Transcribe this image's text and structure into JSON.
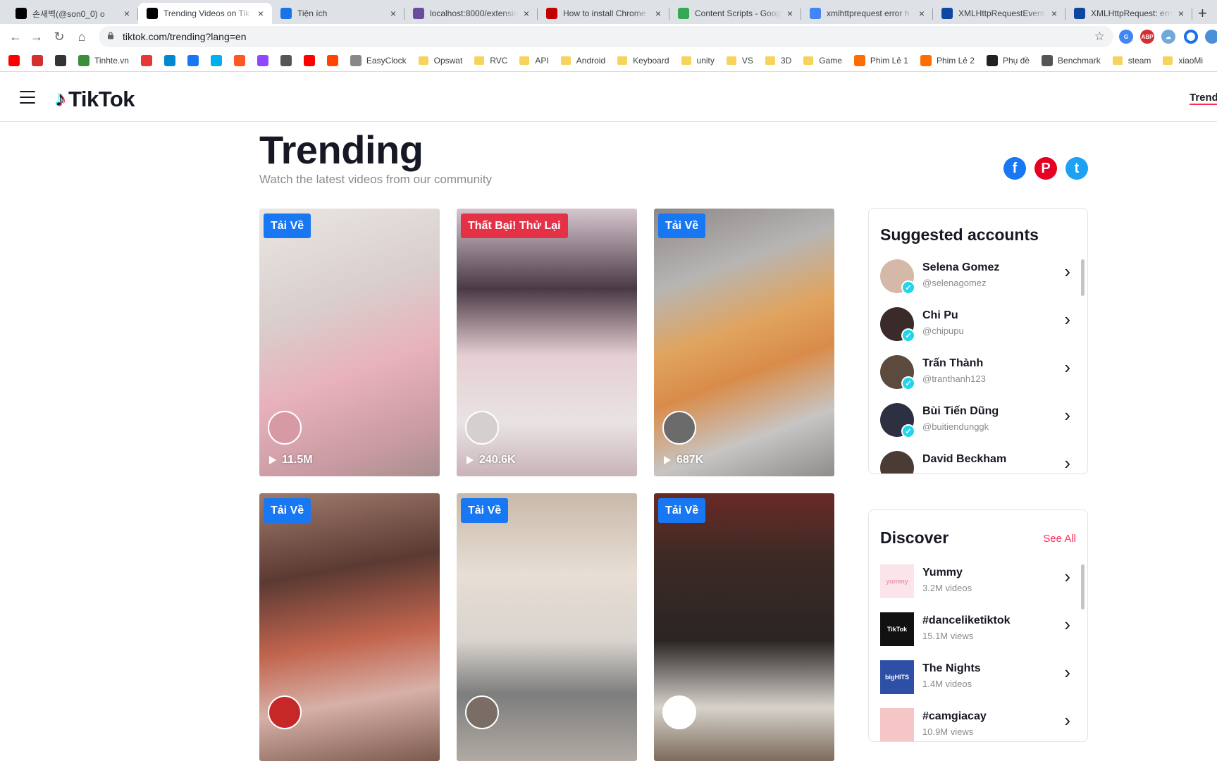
{
  "browser": {
    "tabs": [
      {
        "title": "손새벽(@son0_0) o",
        "favicon": "tiktok-icon",
        "color": "#000000",
        "active": false
      },
      {
        "title": "Trending Videos on Tik",
        "favicon": "tiktok-icon",
        "color": "#000000",
        "active": true
      },
      {
        "title": "Tiện ích",
        "favicon": "puzzle-icon",
        "color": "#1a73e8",
        "active": false
      },
      {
        "title": "localhost:8000/extensio",
        "favicon": "globe-icon",
        "color": "#6a4c9c",
        "active": false
      },
      {
        "title": "How to install Chrome",
        "favicon": "cnet-icon",
        "color": "#c10000",
        "active": false
      },
      {
        "title": "Content Scripts - Goog",
        "favicon": "chrome-icon",
        "color": "#34a853",
        "active": false
      },
      {
        "title": "xmlhttprequest error h",
        "favicon": "google-icon",
        "color": "#4285f4",
        "active": false
      },
      {
        "title": "XMLHttpRequestEvent",
        "favicon": "mortarboard-icon",
        "color": "#0d47a1",
        "active": false
      },
      {
        "title": "XMLHttpRequest: error",
        "favicon": "mortarboard-icon",
        "color": "#0d47a1",
        "active": false
      }
    ],
    "url": "tiktok.com/trending?lang=en",
    "bookmarks": [
      {
        "label": "",
        "icon": "youtube-icon",
        "color": "#ff0000",
        "folder": false
      },
      {
        "label": "",
        "icon": "bookmark-icon",
        "color": "#d32f2f",
        "folder": false
      },
      {
        "label": "",
        "icon": "gk-icon",
        "color": "#333333",
        "folder": false
      },
      {
        "label": "Tinhte.vn",
        "icon": "tinhte-icon",
        "color": "#3b8f3b",
        "folder": false
      },
      {
        "label": "",
        "icon": "circle-icon",
        "color": "#e53935",
        "folder": false
      },
      {
        "label": "",
        "icon": "cloud-icon",
        "color": "#0288d1",
        "folder": false
      },
      {
        "label": "",
        "icon": "facebook-icon",
        "color": "#1877f2",
        "folder": false
      },
      {
        "label": "",
        "icon": "skype-icon",
        "color": "#00aff0",
        "folder": false
      },
      {
        "label": "",
        "icon": "g-icon",
        "color": "#ff5722",
        "folder": false
      },
      {
        "label": "",
        "icon": "twitch-icon",
        "color": "#9146ff",
        "folder": false
      },
      {
        "label": "",
        "icon": "gear-icon",
        "color": "#555555",
        "folder": false
      },
      {
        "label": "",
        "icon": "play-icon",
        "color": "#ff0000",
        "folder": false
      },
      {
        "label": "",
        "icon": "play-icon",
        "color": "#ff4500",
        "folder": false
      },
      {
        "label": "EasyClock",
        "icon": "clock-icon",
        "color": "#888888",
        "folder": false
      },
      {
        "label": "Opswat",
        "icon": "folder-icon",
        "color": "#f7d35c",
        "folder": true
      },
      {
        "label": "RVC",
        "icon": "folder-icon",
        "color": "#f7d35c",
        "folder": true
      },
      {
        "label": "API",
        "icon": "folder-icon",
        "color": "#f7d35c",
        "folder": true
      },
      {
        "label": "Android",
        "icon": "folder-icon",
        "color": "#f7d35c",
        "folder": true
      },
      {
        "label": "Keyboard",
        "icon": "folder-icon",
        "color": "#f7d35c",
        "folder": true
      },
      {
        "label": "unity",
        "icon": "folder-icon",
        "color": "#f7d35c",
        "folder": true
      },
      {
        "label": "VS",
        "icon": "folder-icon",
        "color": "#f7d35c",
        "folder": true
      },
      {
        "label": "3D",
        "icon": "folder-icon",
        "color": "#f7d35c",
        "folder": true
      },
      {
        "label": "Game",
        "icon": "folder-icon",
        "color": "#f7d35c",
        "folder": true
      },
      {
        "label": "Phim Lẻ 1",
        "icon": "flame-icon",
        "color": "#ff6d00",
        "folder": false
      },
      {
        "label": "Phim Lẻ 2",
        "icon": "flame-icon",
        "color": "#ff6d00",
        "folder": false
      },
      {
        "label": "Phụ đề",
        "icon": "subtitle-icon",
        "color": "#222222",
        "folder": false
      },
      {
        "label": "Benchmark",
        "icon": "gamepad-icon",
        "color": "#555555",
        "folder": false
      },
      {
        "label": "steam",
        "icon": "folder-icon",
        "color": "#f7d35c",
        "folder": true
      },
      {
        "label": "xiaoMi",
        "icon": "folder-icon",
        "color": "#f7d35c",
        "folder": true
      }
    ]
  },
  "header": {
    "logo_text": "TikTok",
    "nav_link": "Trendi"
  },
  "page": {
    "title": "Trending",
    "subtitle": "Watch the latest videos from our community"
  },
  "share": [
    {
      "name": "facebook",
      "glyph": "f",
      "color": "#1877f2"
    },
    {
      "name": "pinterest",
      "glyph": "P",
      "color": "#e60023"
    },
    {
      "name": "twitter",
      "glyph": "t",
      "color": "#1da1f2"
    }
  ],
  "videos": [
    {
      "badge": "Tải Về",
      "badge_color": "#1877f2",
      "plays": "11.5M",
      "bg": "linear-gradient(160deg,#eae6e3 0%,#d9cfcd 35%,#e8b1bb 60%,#c89aa2 85%,#a78f8e 100%)",
      "avatar_color": "#d79aa4"
    },
    {
      "badge": "Thất Bại! Thử Lại",
      "badge_color": "#e53146",
      "plays": "240.6K",
      "bg": "linear-gradient(180deg,#d6c7cf 0%,#4a3a45 30%,#e6cfd3 55%,#e9e3e3 80%,#c9b3b7 100%)",
      "avatar_color": "#d6cfd0"
    },
    {
      "badge": "Tải Về",
      "badge_color": "#1877f2",
      "plays": "687K",
      "bg": "linear-gradient(160deg,#8d8887 0%,#b7b5b3 25%,#e0a45f 45%,#d98c4a 60%,#c7c5c4 80%,#8f8c8a 100%)",
      "avatar_color": "#6b6b6b"
    },
    {
      "badge": "Tải Về",
      "badge_color": "#1877f2",
      "plays": "",
      "bg": "linear-gradient(170deg,#a07b6c 0%,#5b3a33 30%,#c2654e 55%,#d7b0a7 75%,#7b5a4e 100%)",
      "avatar_color": "#c62828"
    },
    {
      "badge": "Tải Về",
      "badge_color": "#1877f2",
      "plays": "",
      "bg": "linear-gradient(180deg,#c9b9a9 0%,#e7ded5 30%,#d9d4ce 55%,#7d7d7d 75%,#b1aaa3 100%)",
      "avatar_color": "#7a6d65"
    },
    {
      "badge": "Tải Về",
      "badge_color": "#1877f2",
      "plays": "",
      "bg": "linear-gradient(180deg,#6a2a26 0%,#3b2a25 25%,#2b2524 55%,#d7d3cc 80%,#7e6b5c 100%)",
      "avatar_color": "#ffffff"
    }
  ],
  "suggested": {
    "title": "Suggested accounts",
    "accounts": [
      {
        "name": "Selena Gomez",
        "handle": "@selenagomez",
        "color": "#d4b8a8"
      },
      {
        "name": "Chi Pu",
        "handle": "@chipupu",
        "color": "#3a2a2a"
      },
      {
        "name": "Trấn Thành",
        "handle": "@tranthanh123",
        "color": "#5d4a3e"
      },
      {
        "name": "Bùi Tiến Dũng",
        "handle": "@buitiendunggk",
        "color": "#2d3040"
      },
      {
        "name": "David Beckham",
        "handle": "",
        "color": "#4a3c35"
      }
    ]
  },
  "discover": {
    "title": "Discover",
    "see_all": "See All",
    "items": [
      {
        "name": "Yummy",
        "sub": "3.2M videos",
        "color": "#fbe4ea",
        "thumb_text": "yummy",
        "thumb_text_color": "#e89bb0"
      },
      {
        "name": "#danceliketiktok",
        "sub": "15.1M views",
        "color": "#111111",
        "thumb_text": "TikTok",
        "thumb_text_color": "#ffffff"
      },
      {
        "name": "The Nights",
        "sub": "1.4M videos",
        "color": "#2e4fa6",
        "thumb_text": "bigHITS",
        "thumb_text_color": "#ffffff"
      },
      {
        "name": "#camgiacay",
        "sub": "10.9M views",
        "color": "#f6c6c6",
        "thumb_text": "",
        "thumb_text_color": "#000000"
      }
    ]
  }
}
